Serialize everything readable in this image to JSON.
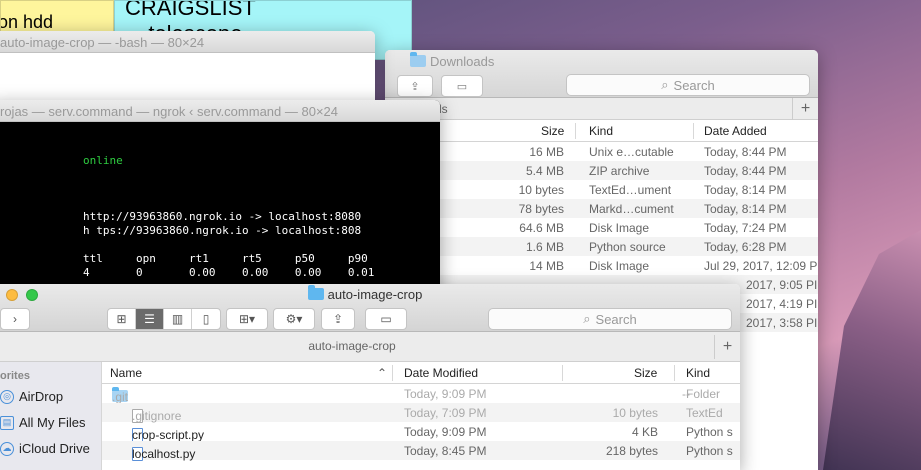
{
  "sticky_notes": {
    "yellow": "on hdd",
    "cyan_line1": "CRAIGSLIST",
    "cyan_line2": "-telescope"
  },
  "terminal_bash": {
    "title": "auto-image-crop — -bash — 80×24"
  },
  "terminal_ngrok": {
    "title": "rojas — serv.command — ngrok ‹ serv.command — 80×24",
    "status": "online",
    "forward1": "http://93963860.ngrok.io -> localhost:8080",
    "forward2": "h tps://93963860.ngrok.io -> localhost:808",
    "stats_header": "ttl     opn     rt1     rt5     p50     p90",
    "stats_values": "4       0       0.00    0.00    0.00    0.01"
  },
  "finder_downloads": {
    "title": "Downloads",
    "search_placeholder": "Search",
    "path_tail": "ds",
    "add_tab": "+",
    "columns": {
      "size": "Size",
      "kind": "Kind",
      "date_added": "Date Added"
    },
    "rows": [
      {
        "size": "16 MB",
        "kind": "Unix e…cutable",
        "date": "Today, 8:44 PM"
      },
      {
        "size": "5.4 MB",
        "kind": "ZIP archive",
        "date": "Today, 8:44 PM"
      },
      {
        "size": "10 bytes",
        "kind": "TextEd…ument",
        "date": "Today, 8:14 PM"
      },
      {
        "size": "78 bytes",
        "kind": "Markd…cument",
        "date": "Today, 8:14 PM"
      },
      {
        "size": "64.6 MB",
        "kind": "Disk Image",
        "date": "Today, 7:24 PM"
      },
      {
        "size": "1.6 MB",
        "kind": "Python source",
        "date": "Today, 6:28 PM"
      },
      {
        "size": "14 MB",
        "kind": "Disk Image",
        "date": "Jul 29, 2017, 12:09 P"
      },
      {
        "size": "",
        "kind": "",
        "date": "2017, 9:05 PI"
      },
      {
        "size": "",
        "kind": "",
        "date": "2017, 4:19 PI"
      },
      {
        "size": "",
        "kind": "",
        "date": "2017, 3:58 PI"
      }
    ]
  },
  "finder_front": {
    "title": "auto-image-crop",
    "path_label": "auto-image-crop",
    "search_placeholder": "Search",
    "add_tab": "+",
    "sidebar_header": "orites",
    "sidebar": [
      {
        "label": "AirDrop",
        "icon": "airdrop-icon"
      },
      {
        "label": "All My Files",
        "icon": "all-files-icon"
      },
      {
        "label": "iCloud Drive",
        "icon": "icloud-icon"
      }
    ],
    "columns": {
      "name": "Name",
      "date_modified": "Date Modified",
      "size": "Size",
      "kind": "Kind"
    },
    "files": [
      {
        "name": ".git",
        "date": "Today, 9:09 PM",
        "size": "--",
        "kind": "Folder"
      },
      {
        "name": ".gitignore",
        "date": "Today, 7:09 PM",
        "size": "10 bytes",
        "kind": "TextEd"
      },
      {
        "name": "crop-script.py",
        "date": "Today, 9:09 PM",
        "size": "4 KB",
        "kind": "Python s"
      },
      {
        "name": "localhost.py",
        "date": "Today, 8:45 PM",
        "size": "218 bytes",
        "kind": "Python s"
      }
    ]
  },
  "colors": {
    "accent_blue": "#5fb7ef",
    "terminal_green": "#2ecc40",
    "close": "#fc605b",
    "minimize": "#fdbc40",
    "zoom": "#34c84a"
  }
}
